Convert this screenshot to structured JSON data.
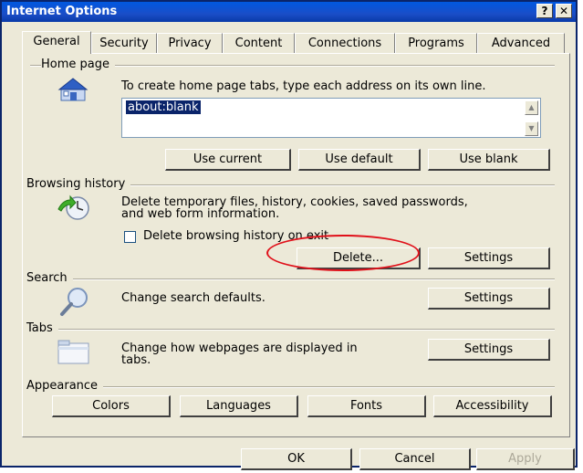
{
  "window": {
    "title": "Internet Options",
    "help_label": "?",
    "close_label": "✕"
  },
  "tabs": [
    {
      "label": "General",
      "active": true
    },
    {
      "label": "Security"
    },
    {
      "label": "Privacy"
    },
    {
      "label": "Content"
    },
    {
      "label": "Connections"
    },
    {
      "label": "Programs"
    },
    {
      "label": "Advanced"
    }
  ],
  "home_page": {
    "group_label": "Home page",
    "instruction": "To create home page tabs, type each address on its own line.",
    "value": "about:blank",
    "buttons": {
      "use_current": "Use current",
      "use_default": "Use default",
      "use_blank": "Use blank"
    }
  },
  "browsing_history": {
    "group_label": "Browsing history",
    "description_line1": "Delete temporary files, history, cookies, saved passwords,",
    "description_line2": "and web form information.",
    "checkbox_label": "Delete browsing history on exit",
    "checkbox_checked": false,
    "delete_label": "Delete...",
    "settings_label": "Settings"
  },
  "search": {
    "group_label": "Search",
    "description": "Change search defaults.",
    "settings_label": "Settings"
  },
  "tabs_section": {
    "group_label": "Tabs",
    "description_line1": "Change how webpages are displayed in",
    "description_line2": "tabs.",
    "settings_label": "Settings"
  },
  "appearance": {
    "group_label": "Appearance",
    "buttons": {
      "colors": "Colors",
      "languages": "Languages",
      "fonts": "Fonts",
      "accessibility": "Accessibility"
    }
  },
  "footer": {
    "ok_label": "OK",
    "cancel_label": "Cancel",
    "apply_label": "Apply"
  },
  "colors": {
    "title_bar": "#0a3aa8",
    "dialog_face": "#ece9d8",
    "highlight_ellipse": "#e0101a"
  }
}
